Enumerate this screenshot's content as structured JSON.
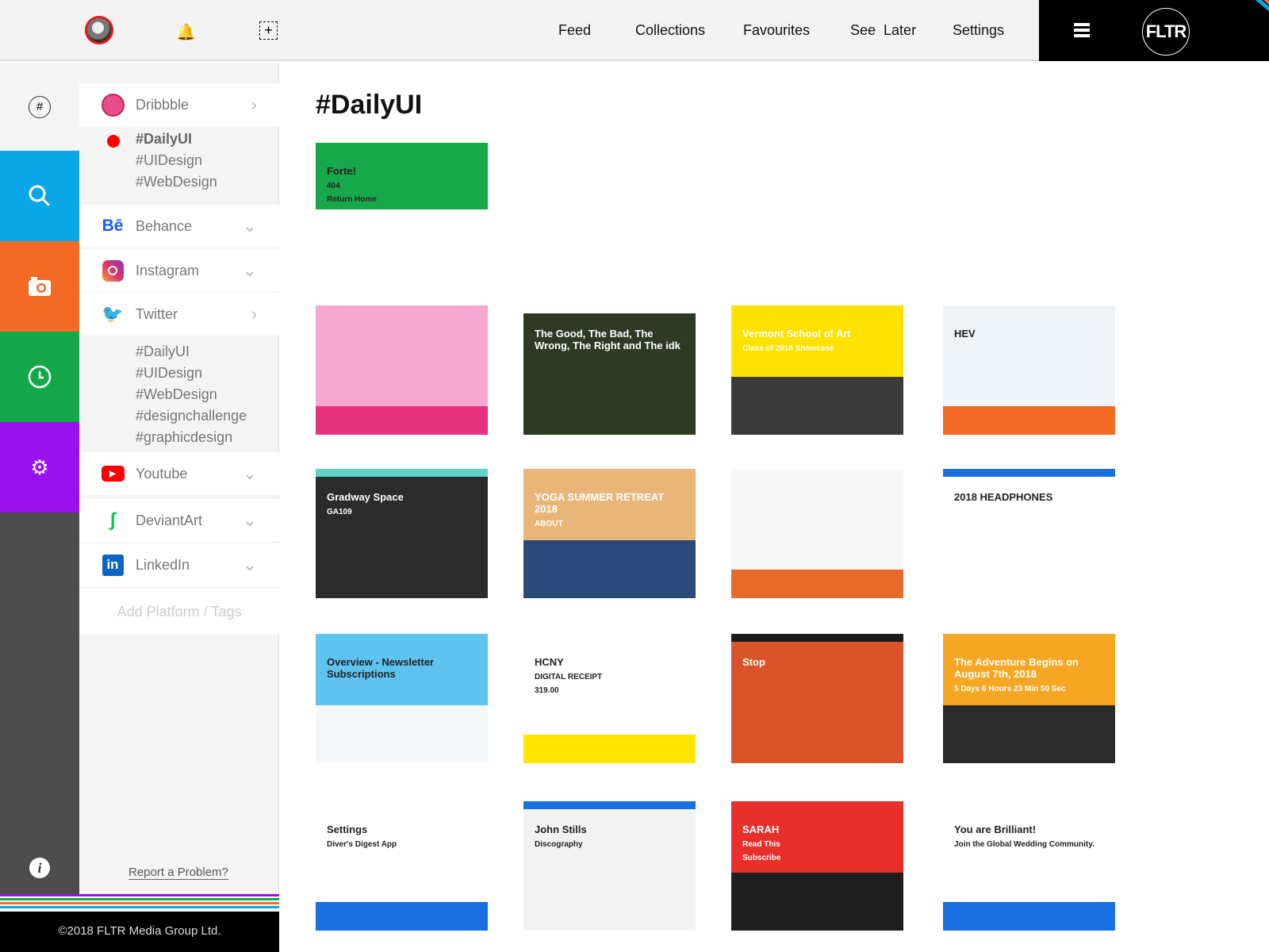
{
  "header": {
    "nav": [
      "Feed",
      "Collections",
      "Favourites",
      "See  Later",
      "Settings"
    ],
    "logo": "FLTR",
    "icons": [
      "avatar",
      "bell-icon",
      "add-icon",
      "menu-icon"
    ]
  },
  "rail": {
    "items": [
      {
        "icon": "hashtag-icon",
        "color": "#f5f4f4"
      },
      {
        "icon": "search-icon",
        "color": "#0aa7e6"
      },
      {
        "icon": "camera-icon",
        "color": "#f26a23"
      },
      {
        "icon": "clock-icon",
        "color": "#14a84a"
      },
      {
        "icon": "gear-icon",
        "color": "#9a11f0"
      },
      {
        "icon": "info-icon",
        "color": "#4d4d4d"
      }
    ]
  },
  "panel": {
    "platforms": [
      {
        "label": "Dribbble",
        "icon": "dribbble-icon",
        "chev": "›"
      },
      {
        "label": "Behance",
        "icon": "behance-icon",
        "chev": "⌄"
      },
      {
        "label": "Instagram",
        "icon": "instagram-icon",
        "chev": "⌄"
      },
      {
        "label": "Twitter",
        "icon": "twitter-icon",
        "chev": "›"
      },
      {
        "label": "Youtube",
        "icon": "youtube-icon",
        "chev": "⌄"
      },
      {
        "label": "DeviantArt",
        "icon": "deviantart-icon",
        "chev": "⌄"
      },
      {
        "label": "LinkedIn",
        "icon": "linkedin-icon",
        "chev": "⌄"
      }
    ],
    "dribbble_tags": [
      "#DailyUI",
      "#UIDesign",
      "#WebDesign"
    ],
    "twitter_tags": [
      "#DailyUI",
      "#UIDesign",
      "#WebDesign",
      "#designchallenge",
      "#graphicdesign"
    ],
    "add_label": "Add Platform / Tags",
    "report_label": "Report a Problem?"
  },
  "footer": {
    "copyright": "©2018 FLTR Media Group Ltd.",
    "stripe_colors": [
      "#9a11f0",
      "#14a84a",
      "#f26a23",
      "#0aa7e6"
    ]
  },
  "main": {
    "title": "#DailyUI",
    "thumbs": [
      {
        "bg": "#ffffff",
        "accent": "#17a84a",
        "texts": [
          "Forte!",
          "404",
          "Return Home"
        ]
      },
      {
        "bg": "#f7a8d0",
        "accent": "#e5337f",
        "texts": []
      },
      {
        "bg": "#2f3a24",
        "accent": "#ffffff",
        "texts": [
          "The Good, The Bad, The Wrong, The Right and The idk"
        ]
      },
      {
        "bg": "#3a3a3a",
        "accent": "#ffe100",
        "texts": [
          "Vermont School of Art",
          "Class of 2018 Showcase"
        ]
      },
      {
        "bg": "#eef3f7",
        "accent": "#f26a23",
        "texts": [
          "HEV"
        ]
      },
      {
        "bg": "#2b2b2b",
        "accent": "#5fd3c4",
        "texts": [
          "Gradway Space",
          "GA109"
        ]
      },
      {
        "bg": "#2a4a7a",
        "accent": "#e9b67a",
        "texts": [
          "YOGA SUMMER RETREAT 2018",
          "ABOUT"
        ]
      },
      {
        "bg": "#f7f7f7",
        "accent": "#e86a2a",
        "texts": []
      },
      {
        "bg": "#ffffff",
        "accent": "#1a6fe0",
        "texts": [
          "2018 HEADPHONES"
        ]
      },
      {
        "bg": "#f4f8fb",
        "accent": "#5ec3ee",
        "texts": [
          "Overview - Newsletter Subscriptions"
        ]
      },
      {
        "bg": "#ffffff",
        "accent": "#ffe500",
        "texts": [
          "HCNY",
          "DIGITAL RECEIPT",
          "319.00"
        ]
      },
      {
        "bg": "#d9542a",
        "accent": "#1c1c1c",
        "texts": [
          "Stop"
        ]
      },
      {
        "bg": "#2b2b2b",
        "accent": "#f5a623",
        "texts": [
          "The Adventure Begins on August 7th, 2018",
          "5 Days  6 Hours  23 Min  50 Sec"
        ]
      },
      {
        "bg": "#ffffff",
        "accent": "#1a6fe0",
        "texts": [
          "Settings",
          "Diver's Digest App"
        ]
      },
      {
        "bg": "#f2f2f2",
        "accent": "#1a6fe0",
        "texts": [
          "John Stills",
          "Discography"
        ]
      },
      {
        "bg": "#1e1e1e",
        "accent": "#e8302a",
        "texts": [
          "SARAH",
          "Read This",
          "Subscribe"
        ]
      },
      {
        "bg": "#ffffff",
        "accent": "#1a6fe0",
        "texts": [
          "You are Brilliant!",
          "Join the Global Wedding Community."
        ]
      }
    ]
  }
}
